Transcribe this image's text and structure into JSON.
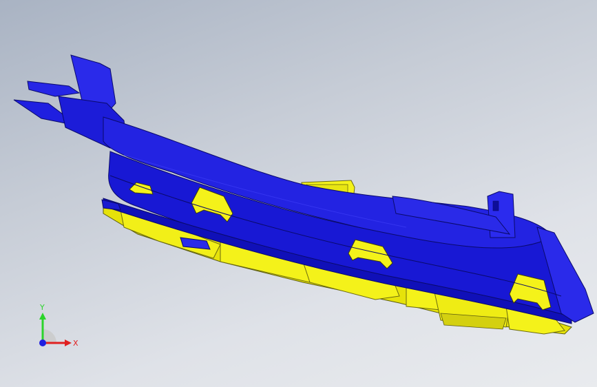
{
  "viewport": {
    "background_top": "#a9b3c3",
    "background_bottom": "#e9ebee"
  },
  "model": {
    "primary_color": "#1f1fe0",
    "secondary_color": "#f5f216",
    "edge_color": "#0a0a6a"
  },
  "triad": {
    "y_label": "Y",
    "x_label": "X",
    "y_color": "#2bd42b",
    "x_color": "#e02020",
    "z_color": "#1f1fe0"
  }
}
